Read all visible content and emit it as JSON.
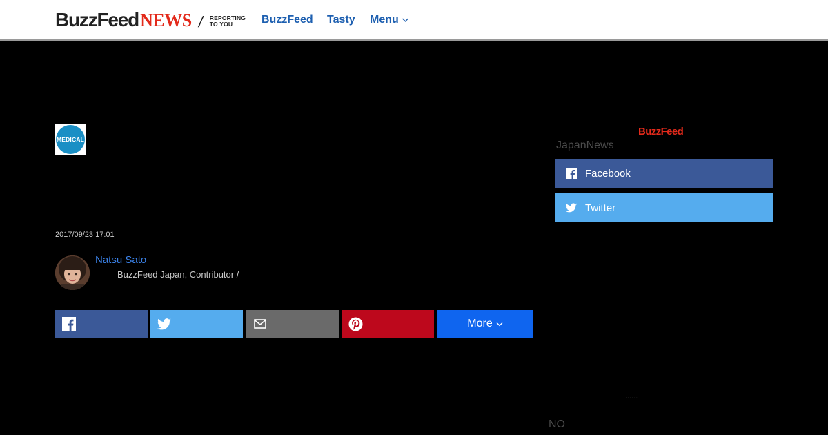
{
  "header": {
    "logo_buzzfeed": "BuzzFeed",
    "logo_news": "NEWS",
    "logo_slash": "/",
    "logo_tag_line1": "REPORTING",
    "logo_tag_line2": "TO YOU",
    "nav": {
      "buzzfeed": "BuzzFeed",
      "tasty": "Tasty",
      "menu": "Menu"
    }
  },
  "article": {
    "badge": "MEDICAL",
    "timestamp": "2017/09/23 17:01",
    "author": {
      "name": "Natsu Sato",
      "title": "BuzzFeed Japan, Contributor /"
    },
    "share": {
      "more_label": "More"
    }
  },
  "sidebar": {
    "logo": "BuzzFeed",
    "japan_news": "JapanNews",
    "facebook_label": "Facebook",
    "twitter_label": "Twitter",
    "dots": "......",
    "no_text": "NO"
  },
  "colors": {
    "facebook": "#3b5998",
    "twitter": "#55acee",
    "mail": "#6a6a6a",
    "pinterest": "#bd081c",
    "more": "#0f65ef",
    "nav_link": "#1d5fb0",
    "brand_red": "#e32a1b"
  }
}
